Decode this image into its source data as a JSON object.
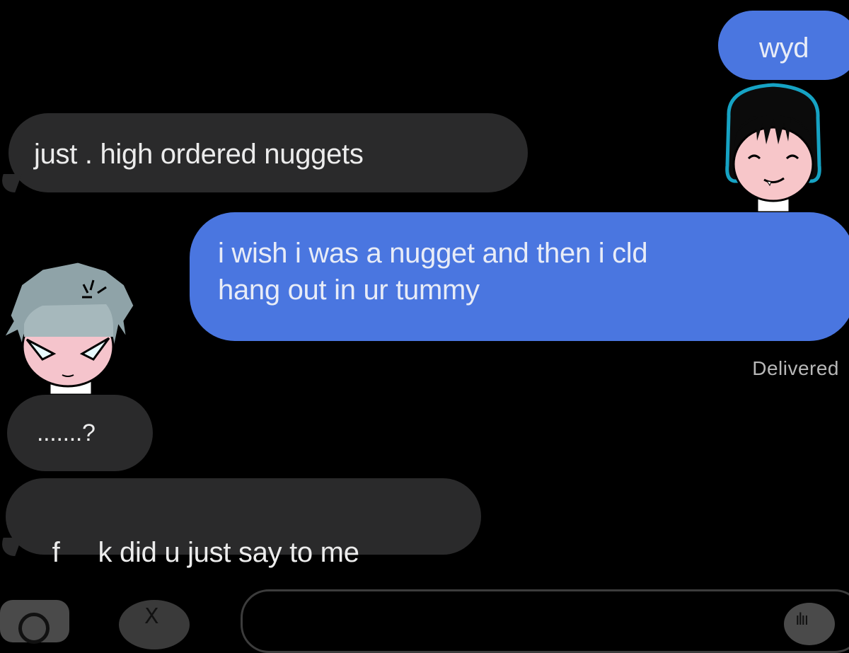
{
  "messages": [
    {
      "side": "sent",
      "text": "wyd"
    },
    {
      "side": "received",
      "text": "just . high ordered nuggets"
    },
    {
      "side": "sent",
      "line1": "i wish i was a nugget and then i cld",
      "line2": "hang out in ur tummy"
    },
    {
      "side": "received",
      "text": ".......?"
    },
    {
      "side": "received",
      "text": "f     k did u just say to me"
    }
  ],
  "status": {
    "delivered": "Delivered"
  },
  "toolbar": {
    "camera_icon": "camera-icon",
    "apps_icon": "app-store-icon",
    "mic_icon": "audio-waveform-icon"
  },
  "colors": {
    "background": "#000000",
    "sent_bubble": "#4a76e0",
    "received_bubble": "#2a2a2b"
  }
}
